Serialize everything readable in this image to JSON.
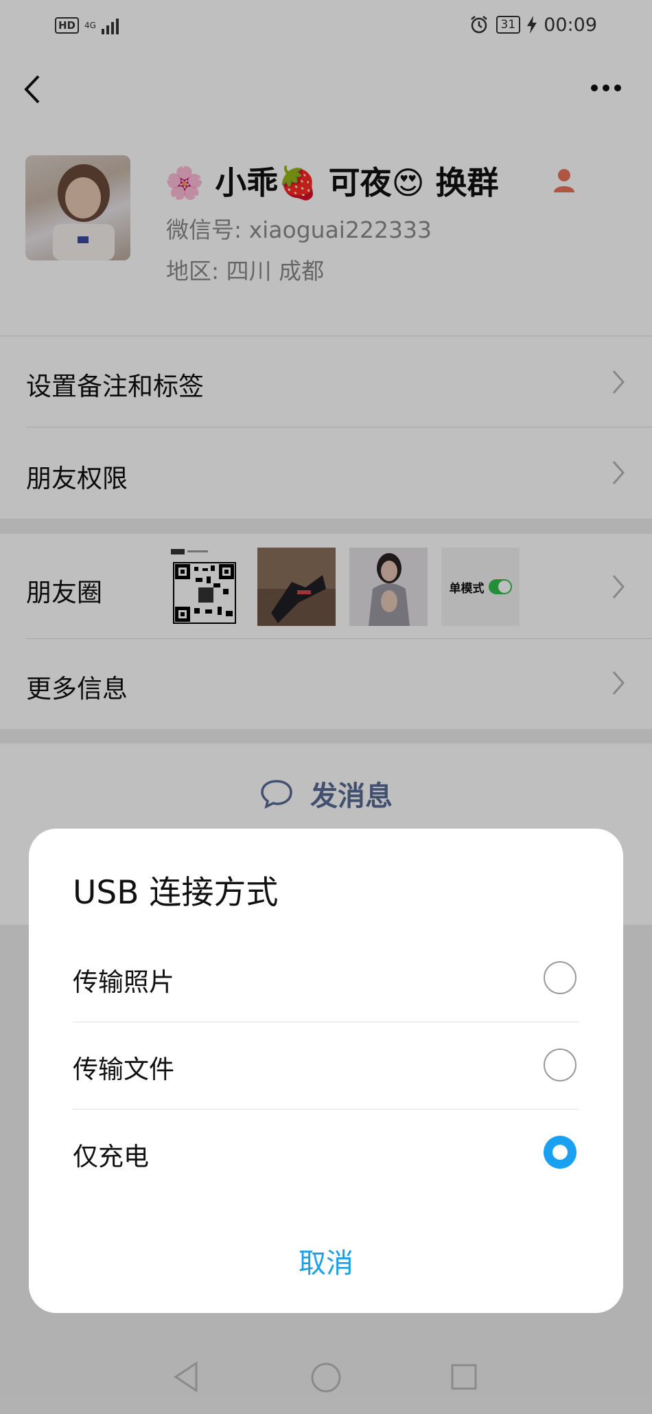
{
  "status_bar": {
    "hd": "HD",
    "network": "4G",
    "battery": "31",
    "time": "00:09"
  },
  "profile": {
    "name": "🌸 小乖🍓 可夜😍 换群",
    "wechat_id": "微信号: xiaoguai222333",
    "region": "地区: 四川  成都"
  },
  "menu": {
    "remarks": "设置备注和标签",
    "permissions": "朋友权限",
    "moments": "朋友圈",
    "more_info": "更多信息"
  },
  "moments_thumbs": {
    "switch_text": "单模式"
  },
  "actions": {
    "send_message": "发消息"
  },
  "usb_dialog": {
    "title": "USB 连接方式",
    "options": [
      {
        "label": "传输照片",
        "selected": false
      },
      {
        "label": "传输文件",
        "selected": false
      },
      {
        "label": "仅充电",
        "selected": true
      }
    ],
    "cancel": "取消"
  },
  "colors": {
    "accent_blue": "#1aa0f0",
    "link_blue": "#1a9fe8",
    "message_blue": "#576b95",
    "switch_green": "#2fbf4f"
  }
}
